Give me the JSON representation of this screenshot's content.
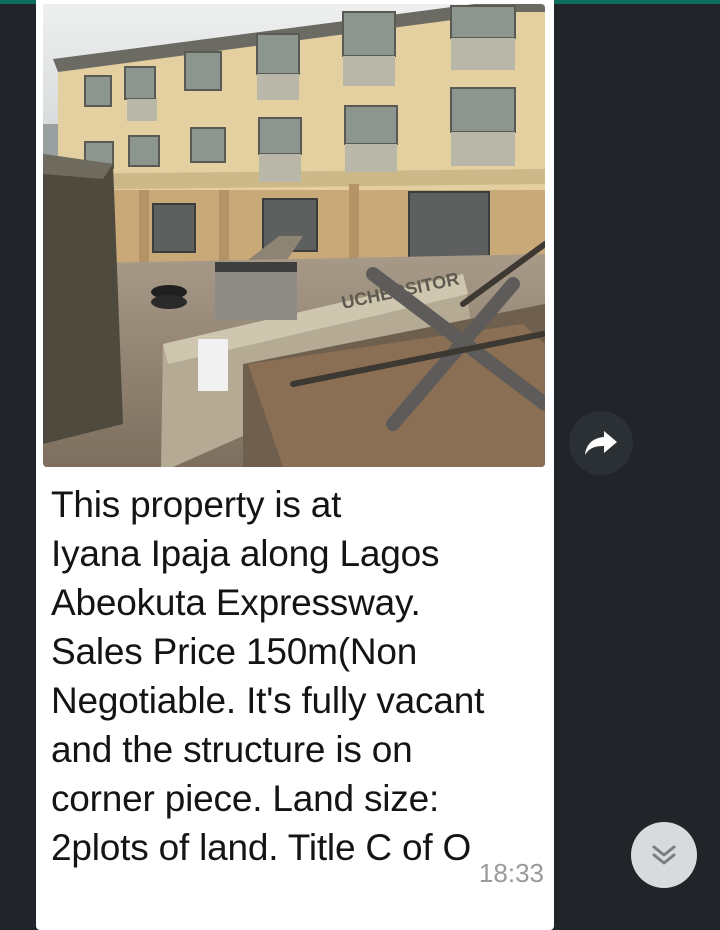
{
  "message": {
    "text": "This property is at\nIyana Ipaja along Lagos\nAbeokuta Expressway.\nSales Price 150m(Non\nNegotiable. It's fully vacant\nand the structure is on\ncorner piece. Land size:\n2plots of land. Title C of O",
    "time": "18:33",
    "image": {
      "icon": "building-photo"
    }
  },
  "actions": {
    "forward_icon": "share-arrow-icon",
    "scroll_icon": "double-chevron-down-icon"
  },
  "colors": {
    "chat_background": "#212529",
    "bubble": "#ffffff",
    "text": "#141414",
    "timestamp": "#9a9a9a",
    "accent_bar": "#0d6e5f"
  }
}
